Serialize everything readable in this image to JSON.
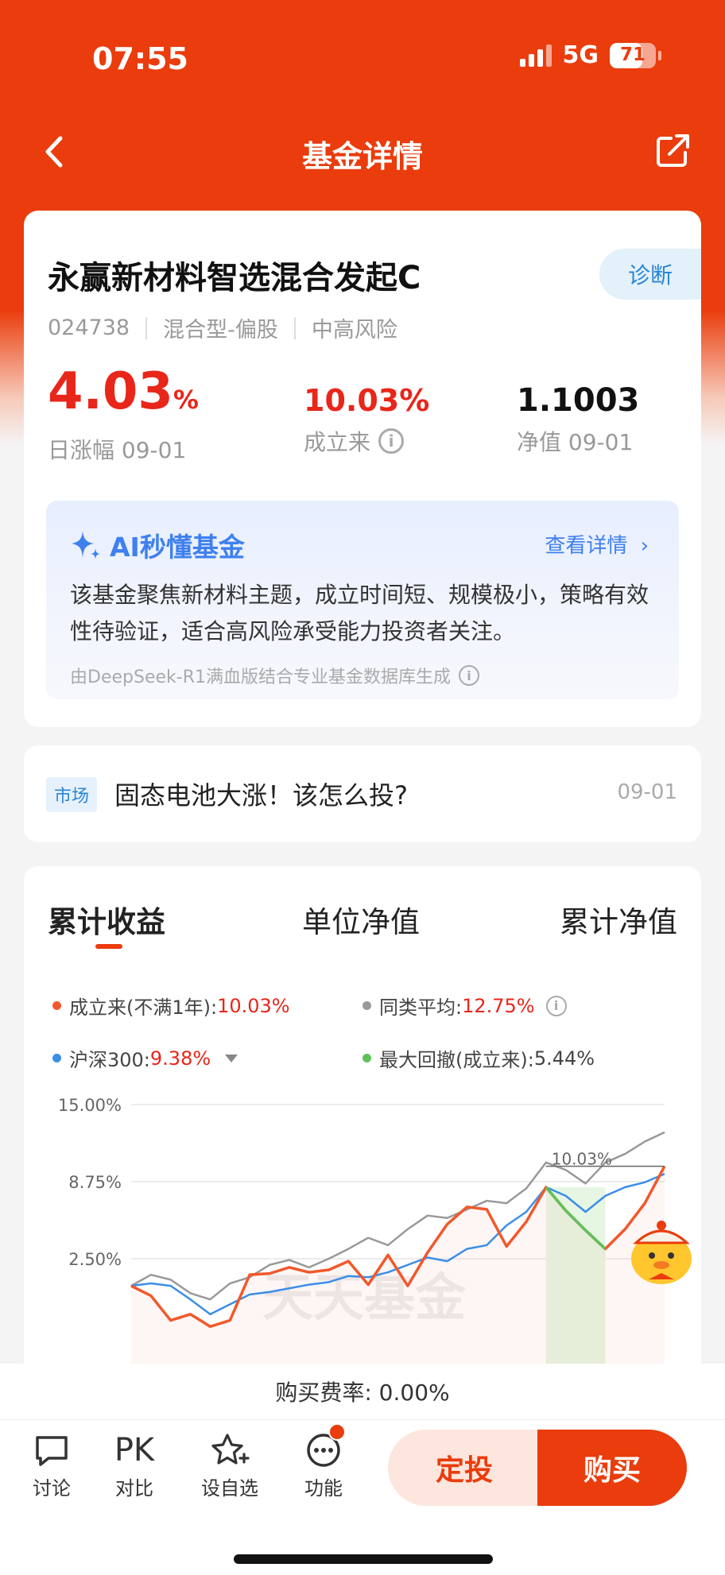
{
  "status_bar": {
    "time": "07:55",
    "network": "5G",
    "battery": "71",
    "battery_level": 0.71
  },
  "nav": {
    "title": "基金详情"
  },
  "fund": {
    "name": "永赢新材料智选混合发起C",
    "diagnose_label": "诊断",
    "code": "024738",
    "type": "混合型-偏股",
    "risk": "中高风险",
    "daily_change": "4.03",
    "daily_change_unit": "%",
    "daily_change_label": "日涨幅 09-01",
    "since_inception": "10.03%",
    "since_inception_label": "成立来",
    "nav_value": "1.1003",
    "nav_label": "净值 09-01"
  },
  "ai": {
    "title": "AI秒懂基金",
    "detail_link": "查看详情",
    "summary": "该基金聚焦新材料主题，成立时间短、规模极小，策略有效性待验证，适合高风险承受能力投资者关注。",
    "source": "由DeepSeek-R1满血版结合专业基金数据库生成"
  },
  "news": {
    "tag": "市场",
    "title": "固态电池大涨！该怎么投?",
    "date": "09-01"
  },
  "chart_tabs": [
    "累计收益",
    "单位净值",
    "累计净值"
  ],
  "legend": {
    "fund_label": "成立来(不满1年):",
    "fund_value": "10.03%",
    "peer_label": "同类平均:",
    "peer_value": "12.75%",
    "index_label": "沪深300:",
    "index_value": "9.38%",
    "drawdown_label": "最大回撤(成立来):",
    "drawdown_value": "5.44%"
  },
  "colors": {
    "fund": "#f2582b",
    "peer": "#999999",
    "index": "#3b8ee8",
    "drawdown": "#5fc15a",
    "accent": "#ea3c0c"
  },
  "chart_data": {
    "type": "line",
    "yticks": [
      "15.00%",
      "8.75%",
      "2.50%"
    ],
    "ylim": [
      -1.5,
      15
    ],
    "end_label": "10.03%",
    "watermark": "天天基金",
    "series": [
      {
        "name": "成立来(不满1年)",
        "values": [
          0.3,
          -0.5,
          -2.5,
          -2.0,
          -3.0,
          -2.5,
          1.2,
          1.3,
          1.8,
          1.4,
          1.6,
          2.3,
          0.4,
          2.8,
          0.3,
          3.0,
          5.3,
          6.7,
          6.5,
          3.5,
          5.5,
          8.3,
          6.4,
          4.8,
          3.3,
          4.9,
          7.0,
          10.0
        ]
      },
      {
        "name": "同类平均",
        "values": [
          0.3,
          1.2,
          0.8,
          -0.3,
          -0.8,
          0.5,
          1.0,
          2.0,
          2.4,
          1.8,
          2.5,
          3.3,
          4.2,
          3.6,
          4.9,
          6.0,
          5.8,
          6.5,
          7.2,
          7.0,
          8.2,
          10.3,
          9.7,
          8.6,
          10.3,
          11.0,
          12.0,
          12.75
        ]
      },
      {
        "name": "沪深300",
        "values": [
          0.3,
          0.5,
          0.3,
          -0.8,
          -2.0,
          -1.2,
          -0.4,
          -0.2,
          0.1,
          0.4,
          0.6,
          1.1,
          1.0,
          1.4,
          2.0,
          2.6,
          2.3,
          3.3,
          3.6,
          5.2,
          6.3,
          8.3,
          7.6,
          6.3,
          7.6,
          8.3,
          8.7,
          9.38
        ]
      }
    ],
    "drawdown": {
      "from_index": 21,
      "to_index": 24
    }
  },
  "footer": {
    "fee": "购买费率: 0.00%",
    "actions": [
      "讨论",
      "对比",
      "设自选",
      "功能"
    ],
    "pk_label": "PK",
    "dingtou": "定投",
    "buy": "购买"
  }
}
